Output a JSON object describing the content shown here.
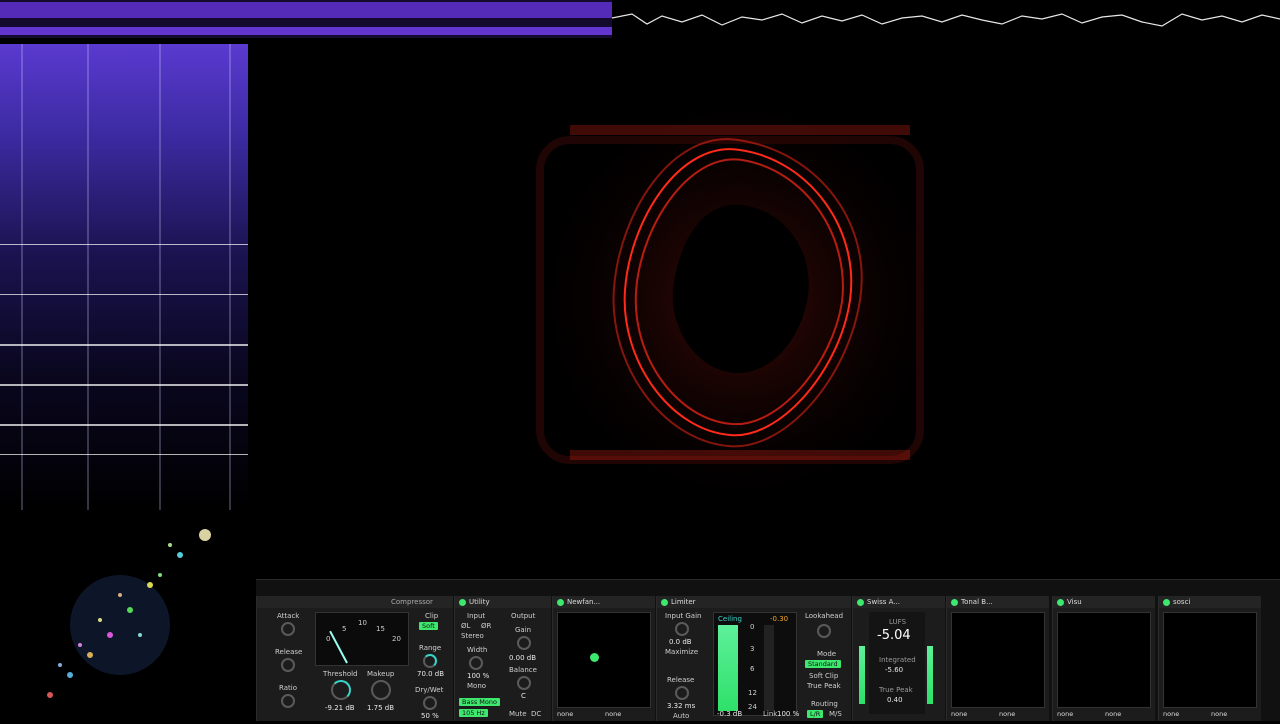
{
  "window_controls": {
    "record_icon": "record-icon",
    "pin_icon": "pin-icon",
    "popout_icon": "popout-icon",
    "fullscreen_icon": "fullscreen-icon"
  },
  "rack": {
    "compressor": {
      "title": "Compressor",
      "attack": "Attack",
      "release": "Release",
      "ratio": "Ratio",
      "clip": "Clip",
      "soft": "Soft",
      "threshold_label": "Threshold",
      "threshold_value": "-9.21 dB",
      "makeup_label": "Makeup",
      "makeup_value": "1.75 dB",
      "range_label": "Range",
      "range_value": "70.0 dB",
      "drywet_label": "Dry/Wet",
      "drywet_value": "50 %",
      "meter_ticks": [
        "0",
        "5",
        "10",
        "15",
        "20"
      ]
    },
    "utility": {
      "title": "Utility",
      "input": "Input",
      "phase_l": "ØL",
      "phase_r": "ØR",
      "stereo": "Stereo",
      "width_label": "Width",
      "width_value": "100 %",
      "mono": "Mono",
      "bass_mono": "Bass Mono",
      "bass_freq": "105 Hz",
      "output": "Output",
      "gain_label": "Gain",
      "gain_value": "0.00 dB",
      "balance_label": "Balance",
      "balance_value": "C",
      "mute": "Mute",
      "dc": "DC"
    },
    "newfangled": {
      "title": "Newfan...",
      "sel1": "none",
      "sel2": "none"
    },
    "limiter": {
      "title": "Limiter",
      "input_gain_label": "Input Gain",
      "input_gain_value": "0.0 dB",
      "maximize": "Maximize",
      "release_label": "Release",
      "release_value": "3.32 ms",
      "auto": "Auto",
      "ceiling_label": "Ceiling",
      "ceiling_value": "-0.3 dB",
      "peak_value": "-0.30",
      "link_label": "Link",
      "link_value": "100 %",
      "lookahead_label": "Lookahead",
      "mode_label": "Mode",
      "mode_value": "Standard",
      "soft_clip": "Soft Clip",
      "true_peak": "True Peak",
      "routing_label": "Routing",
      "routing_lr": "L/R",
      "routing_ms": "M/S",
      "scale": [
        "0",
        "3",
        "6",
        "12",
        "24"
      ]
    },
    "swiss": {
      "title": "Swiss A...",
      "lufs_label": "LUFS",
      "lufs_value": "-5.04",
      "integrated_label": "Integrated",
      "integrated_value": "-5.60",
      "truepeak_label": "True Peak",
      "truepeak_value": "0.40"
    },
    "tonal": {
      "title": "Tonal B...",
      "sel1": "none",
      "sel2": "none"
    },
    "visu": {
      "title": "Visu",
      "sel1": "none",
      "sel2": "none"
    },
    "sosci": {
      "title": "sosci",
      "sel1": "none",
      "sel2": "none"
    }
  },
  "colors": {
    "accent_green": "#3ee86e",
    "teal": "#3ad3c8",
    "lissajous": "#ff2a1a",
    "spectrogram": "#5a3ad0"
  }
}
